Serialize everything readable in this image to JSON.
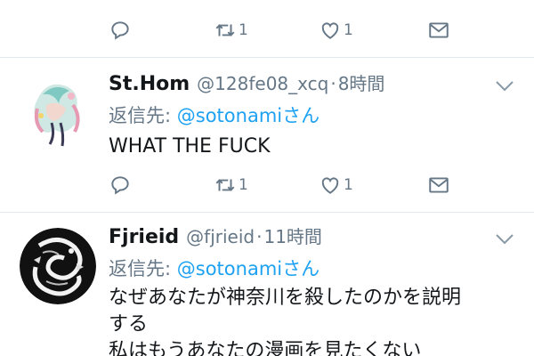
{
  "top_actions": {
    "retweet_count": "1",
    "like_count": "1"
  },
  "tweets": [
    {
      "name": "St.Hom",
      "handle": "@128fe08_xcq",
      "separator": "·",
      "time": "8時間",
      "reply_prefix": "返信先: ",
      "reply_to": "@sotonamiさん",
      "text": "WHAT THE FUCK",
      "retweet_count": "1",
      "like_count": "1"
    },
    {
      "name": "Fjrieid",
      "handle": "@fjrieid",
      "separator": "·",
      "time": "11時間",
      "reply_prefix": "返信先: ",
      "reply_to": "@sotonamiさん",
      "text_lines": [
        "なぜあなたが神奈川を殺したのかを説明",
        "する",
        "私はもうあなたの漫画を見たくない"
      ]
    }
  ],
  "icons": [
    "reply-icon",
    "retweet-icon",
    "like-icon",
    "dm-icon",
    "chevron-down-icon"
  ],
  "colors": {
    "link": "#1da1f2",
    "muted": "#657786",
    "text": "#14171a",
    "divider": "#e1e8ed"
  }
}
